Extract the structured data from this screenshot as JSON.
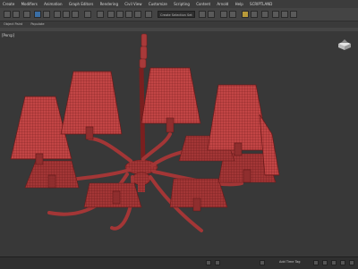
{
  "menubar": {
    "items": [
      "Create",
      "Modifiers",
      "Animation",
      "Graph Editors",
      "Rendering",
      "Civil View",
      "Customize",
      "Scripting",
      "Content",
      "Arnold",
      "Help",
      "SCRIPTLAND"
    ]
  },
  "toolbar": {
    "create_selection_set": "Create Selection Set"
  },
  "sub_toolbar": {
    "items": [
      "Object Paint",
      "Populate"
    ]
  },
  "viewport": {
    "label": "[Persp]",
    "model": "chandelier-wireframe",
    "wire_color": "#b23a3a"
  },
  "statusbar": {
    "status_text": "",
    "time_tag": "Add Time Tag"
  },
  "colors": {
    "ui_dark": "#2b2b2b",
    "viewport_bg": "#383838",
    "shade_fill": "#c24545",
    "wire": "#7a1f1f"
  },
  "icons": [
    "select-icon",
    "move-icon",
    "rotate-icon",
    "scale-icon",
    "snap-icon",
    "mirror-icon",
    "align-icon",
    "render-icon",
    "material-editor-icon",
    "viewcube-home-icon"
  ]
}
